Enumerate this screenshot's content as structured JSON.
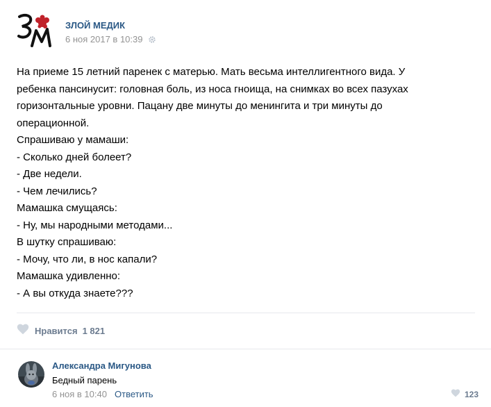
{
  "post": {
    "author": "ЗЛОЙ МЕДИК",
    "date": "6 ноя 2017 в 10:39",
    "logo_icon": "zm-logo-icon",
    "text_lines": [
      "На приеме 15 летний паренек с матерью. Мать весьма интеллигентного вида. У",
      "ребенка пансинусит: головная боль, из носа гноища, на снимках во всех пазухах",
      "горизонтальные уровни. Пацану две минуты до менингита и три минуты до",
      "операционной.",
      "Спрашиваю у мамаши:",
      "- Сколько дней болеет?",
      "- Две недели.",
      "- Чем лечились?",
      "Мамашка смущаясь:",
      "- Ну, мы народными методами...",
      "В шутку спрашиваю:",
      "- Мочу, что ли, в нос капали?",
      "Мамашка удивленно:",
      "- А вы откуда знаете???"
    ],
    "like_label": "Нравится",
    "like_count": "1 821"
  },
  "comment": {
    "author": "Александра Мигунова",
    "text": "Бедный парень",
    "date": "6 ноя в 10:40",
    "reply_label": "Ответить",
    "like_count": "123"
  },
  "colors": {
    "link": "#2a5885",
    "muted": "#939393",
    "like_gray": "#cfd6de",
    "logo_red": "#c0222a"
  }
}
